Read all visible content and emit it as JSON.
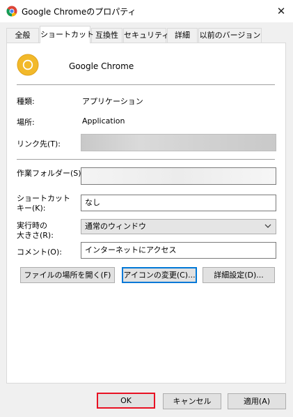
{
  "window": {
    "title": "Google Chromeのプロパティ",
    "close_glyph": "✕"
  },
  "tabs": [
    {
      "label": "全般"
    },
    {
      "label": "ショートカット",
      "active": true
    },
    {
      "label": "互換性"
    },
    {
      "label": "セキュリティ"
    },
    {
      "label": "詳細"
    },
    {
      "label": "以前のバージョン"
    }
  ],
  "header": {
    "name": "Google Chrome",
    "icon": "chrome-canary-icon"
  },
  "props": {
    "type_label": "種類:",
    "type_value": "アプリケーション",
    "location_label": "場所:",
    "location_value": "Application",
    "target_label": "リンク先(T):",
    "target_value": "",
    "startin_label": "作業フォルダー(S):",
    "startin_value": "",
    "shortcut_label_line1": "ショートカット",
    "shortcut_label_line2": "キー(K):",
    "shortcut_value": "なし",
    "run_label_line1": "実行時の",
    "run_label_line2": "大きさ(R):",
    "run_value": "通常のウィンドウ",
    "comment_label": "コメント(O):",
    "comment_value": "インターネットにアクセス"
  },
  "panel_buttons": {
    "open_location": "ファイルの場所を開く(F)",
    "change_icon": "アイコンの変更(C)...",
    "advanced": "詳細設定(D)..."
  },
  "dialog_buttons": {
    "ok": "OK",
    "cancel": "キャンセル",
    "apply": "適用(A)"
  },
  "colors": {
    "focus_blue": "#0078d7",
    "highlight_red": "#e81123",
    "canary_yellow": "#f2b92a"
  }
}
